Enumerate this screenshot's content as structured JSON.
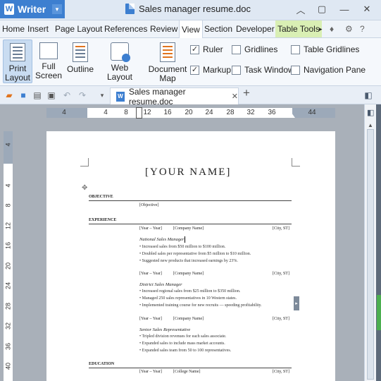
{
  "app": {
    "name": "Writer",
    "doc_title": "Sales manager resume.doc"
  },
  "window": {
    "minimize": "—",
    "restore": "▢",
    "close": "✕",
    "collapse": "︿",
    "skin": "▢"
  },
  "menus": [
    "Home",
    "Insert",
    "Page Layout",
    "References",
    "Review",
    "View",
    "Section",
    "Developer",
    "Table Tools"
  ],
  "menu_extra": {
    "more": "▸",
    "help": "?"
  },
  "ribbon": {
    "print_layout": "Print Layout",
    "full_screen": "Full Screen",
    "outline": "Outline",
    "web_layout": "Web Layout",
    "document_map": "Document Map",
    "checks": [
      {
        "label": "Ruler",
        "checked": true
      },
      {
        "label": "Gridlines",
        "checked": false
      },
      {
        "label": "Table Gridlines",
        "checked": false
      },
      {
        "label": "Markup",
        "checked": true
      },
      {
        "label": "Task Window",
        "checked": false
      },
      {
        "label": "Navigation Pane",
        "checked": false
      }
    ]
  },
  "tab": {
    "label": "Sales manager resume.doc",
    "close": "✕",
    "add": "+"
  },
  "ruler_h": [
    "4",
    "4",
    "8",
    "12",
    "16",
    "20",
    "24",
    "28",
    "32",
    "36",
    "44"
  ],
  "ruler_v": [
    "4",
    "4",
    "8",
    "12",
    "16",
    "20",
    "24",
    "28",
    "32",
    "36",
    "40"
  ],
  "doc": {
    "name_heading": "[YOUR NAME]",
    "objective_h": "OBJECTIVE",
    "objective": "[Objective]",
    "experience_h": "EXPERIENCE",
    "jobs": [
      {
        "years": "[Year – Year]",
        "company": "[Company Name]",
        "city": "[City, ST]",
        "title": "National Sales Manager",
        "bullets": [
          "Increased sales from $50 million to $100 million.",
          "Doubled sales per representative from $5 million to $10 million.",
          "Suggested new products that increased earnings by 23%."
        ]
      },
      {
        "years": "[Year – Year]",
        "company": "[Company Name]",
        "city": "[City, ST]",
        "title": "District Sales Manager",
        "bullets": [
          "Increased regional sales from $25 million to $350 million.",
          "Managed 250 sales representatives in 10 Western states.",
          "Implemented training course for new recruits — speeding profitability."
        ]
      },
      {
        "years": "[Year – Year]",
        "company": "[Company Name]",
        "city": "[City, ST]",
        "title": "Senior Sales Representative",
        "bullets": [
          "Tripled division revenues for each sales associate.",
          "Expanded sales to include mass market accounts.",
          "Expanded sales team from 50 to 100 representatives."
        ]
      }
    ],
    "education_h": "EDUCATION",
    "edu": {
      "years": "[Year – Year]",
      "school": "[College Name]",
      "city": "[City, ST]"
    }
  }
}
